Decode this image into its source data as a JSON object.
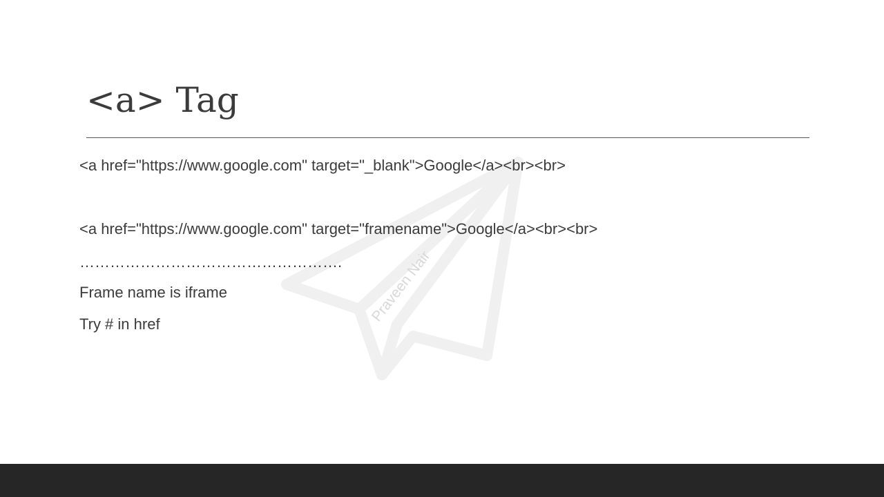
{
  "slide": {
    "title": "<a> Tag",
    "lines": [
      "<a href=\"https://www.google.com\" target=\"_blank\">Google</a><br><br>",
      "<a href=\"https://www.google.com\" target=\"framename\">Google</a><br><br>",
      "…………………………………………….",
      "Frame name is iframe",
      "Try # in href"
    ],
    "watermark": {
      "icon": "paper-plane-icon",
      "text": "Praveen Nair"
    }
  },
  "colors": {
    "text": "#3b3b3b",
    "rule": "#555555",
    "footer": "#262626",
    "watermark": "#f0f0f0"
  }
}
